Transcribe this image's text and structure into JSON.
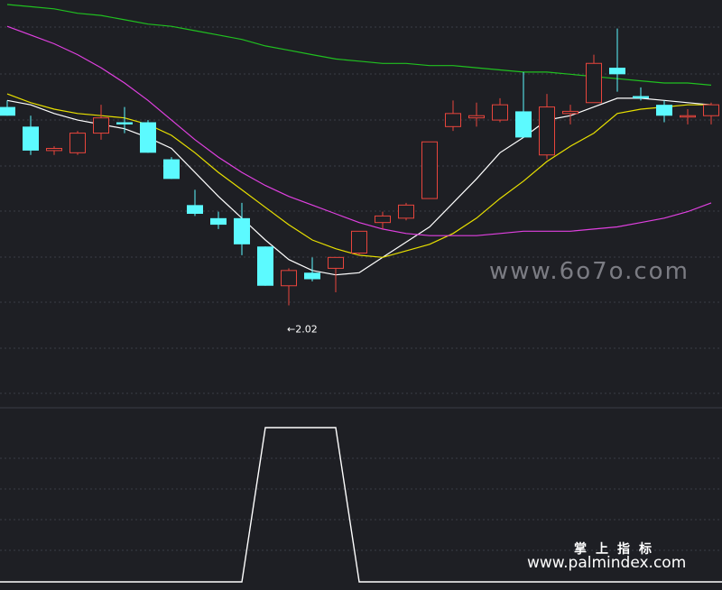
{
  "watermarks": {
    "center": "www.6o7o.com",
    "brand_cn": "掌上指标",
    "brand_url": "www.palmindex.com"
  },
  "colors": {
    "background": "#1e1f24",
    "grid": "#3a3c46",
    "up_candle": "#e8453c",
    "down_candle": "#5cfaff",
    "ma_white": "#ffffff",
    "ma_yellow": "#e8e000",
    "ma_magenta": "#e040e0",
    "ma_green": "#20c020",
    "indicator_line": "#ffffff"
  },
  "chart_data": [
    {
      "type": "candlestick",
      "title": "",
      "price_range": [
        1.45,
        3.25
      ],
      "grid": true,
      "candles": [
        {
          "o": 2.78,
          "h": 2.81,
          "l": 2.74,
          "c": 2.74
        },
        {
          "o": 2.69,
          "h": 2.74,
          "l": 2.56,
          "c": 2.58
        },
        {
          "o": 2.58,
          "h": 2.6,
          "l": 2.56,
          "c": 2.59
        },
        {
          "o": 2.57,
          "h": 2.67,
          "l": 2.56,
          "c": 2.66
        },
        {
          "o": 2.66,
          "h": 2.79,
          "l": 2.63,
          "c": 2.73
        },
        {
          "o": 2.71,
          "h": 2.78,
          "l": 2.66,
          "c": 2.7
        },
        {
          "o": 2.71,
          "h": 2.72,
          "l": 2.57,
          "c": 2.57
        },
        {
          "o": 2.54,
          "h": 2.55,
          "l": 2.45,
          "c": 2.45
        },
        {
          "o": 2.33,
          "h": 2.4,
          "l": 2.28,
          "c": 2.29
        },
        {
          "o": 2.27,
          "h": 2.3,
          "l": 2.22,
          "c": 2.24
        },
        {
          "o": 2.27,
          "h": 2.34,
          "l": 2.1,
          "c": 2.15
        },
        {
          "o": 2.14,
          "h": 2.14,
          "l": 1.96,
          "c": 1.96
        },
        {
          "o": 1.96,
          "h": 2.04,
          "l": 1.87,
          "c": 2.03
        },
        {
          "o": 2.02,
          "h": 2.09,
          "l": 1.98,
          "c": 1.99
        },
        {
          "o": 2.04,
          "h": 2.05,
          "l": 1.93,
          "c": 2.09
        },
        {
          "o": 2.11,
          "h": 2.21,
          "l": 2.1,
          "c": 2.21
        },
        {
          "o": 2.25,
          "h": 2.3,
          "l": 2.22,
          "c": 2.28
        },
        {
          "o": 2.27,
          "h": 2.34,
          "l": 2.26,
          "c": 2.33
        },
        {
          "o": 2.36,
          "h": 2.62,
          "l": 2.36,
          "c": 2.62
        },
        {
          "o": 2.69,
          "h": 2.81,
          "l": 2.67,
          "c": 2.75
        },
        {
          "o": 2.73,
          "h": 2.8,
          "l": 2.69,
          "c": 2.74
        },
        {
          "o": 2.72,
          "h": 2.82,
          "l": 2.71,
          "c": 2.79
        },
        {
          "o": 2.76,
          "h": 2.94,
          "l": 2.64,
          "c": 2.64
        },
        {
          "o": 2.56,
          "h": 2.84,
          "l": 2.54,
          "c": 2.78
        },
        {
          "o": 2.75,
          "h": 2.79,
          "l": 2.7,
          "c": 2.76
        },
        {
          "o": 2.8,
          "h": 3.02,
          "l": 2.8,
          "c": 2.98
        },
        {
          "o": 2.96,
          "h": 3.14,
          "l": 2.85,
          "c": 2.93
        },
        {
          "o": 2.83,
          "h": 2.87,
          "l": 2.81,
          "c": 2.82
        },
        {
          "o": 2.79,
          "h": 2.81,
          "l": 2.71,
          "c": 2.74
        },
        {
          "o": 2.74,
          "h": 2.77,
          "l": 2.7,
          "c": 2.74
        },
        {
          "o": 2.74,
          "h": 2.8,
          "l": 2.7,
          "c": 2.79
        }
      ],
      "ma_lines": [
        {
          "color": "white",
          "values": [
            2.81,
            2.79,
            2.75,
            2.72,
            2.7,
            2.68,
            2.64,
            2.59,
            2.48,
            2.37,
            2.27,
            2.17,
            2.08,
            2.03,
            2.01,
            2.02,
            2.09,
            2.16,
            2.23,
            2.34,
            2.45,
            2.57,
            2.64,
            2.72,
            2.74,
            2.78,
            2.82,
            2.82,
            2.81,
            2.8,
            2.79
          ]
        },
        {
          "color": "yellow",
          "values": [
            2.84,
            2.8,
            2.77,
            2.75,
            2.74,
            2.73,
            2.7,
            2.65,
            2.57,
            2.48,
            2.4,
            2.32,
            2.24,
            2.17,
            2.13,
            2.1,
            2.09,
            2.12,
            2.15,
            2.2,
            2.27,
            2.36,
            2.44,
            2.53,
            2.6,
            2.66,
            2.75,
            2.77,
            2.78,
            2.79,
            2.79
          ]
        },
        {
          "color": "magenta",
          "values": [
            3.15,
            3.11,
            3.07,
            3.02,
            2.96,
            2.89,
            2.81,
            2.72,
            2.63,
            2.55,
            2.48,
            2.42,
            2.37,
            2.33,
            2.29,
            2.25,
            2.22,
            2.2,
            2.19,
            2.19,
            2.19,
            2.2,
            2.21,
            2.21,
            2.21,
            2.22,
            2.23,
            2.25,
            2.27,
            2.3,
            2.34
          ]
        },
        {
          "color": "green",
          "values": [
            3.25,
            3.24,
            3.23,
            3.21,
            3.2,
            3.18,
            3.16,
            3.15,
            3.13,
            3.11,
            3.09,
            3.06,
            3.04,
            3.02,
            3.0,
            2.99,
            2.98,
            2.98,
            2.97,
            2.97,
            2.96,
            2.95,
            2.94,
            2.94,
            2.93,
            2.92,
            2.91,
            2.9,
            2.89,
            2.89,
            2.88
          ]
        }
      ],
      "low_marker": {
        "index": 12,
        "label": "←2.02"
      }
    },
    {
      "type": "line",
      "title": "",
      "y_range": [
        0,
        1
      ],
      "grid": true,
      "series": [
        {
          "values": [
            0,
            0,
            0,
            0,
            0,
            0,
            0,
            0,
            0,
            0,
            0,
            1,
            1,
            1,
            1,
            0,
            0,
            0,
            0,
            0,
            0,
            0,
            0,
            0,
            0,
            0,
            0,
            0,
            0,
            0,
            0
          ]
        }
      ]
    }
  ]
}
